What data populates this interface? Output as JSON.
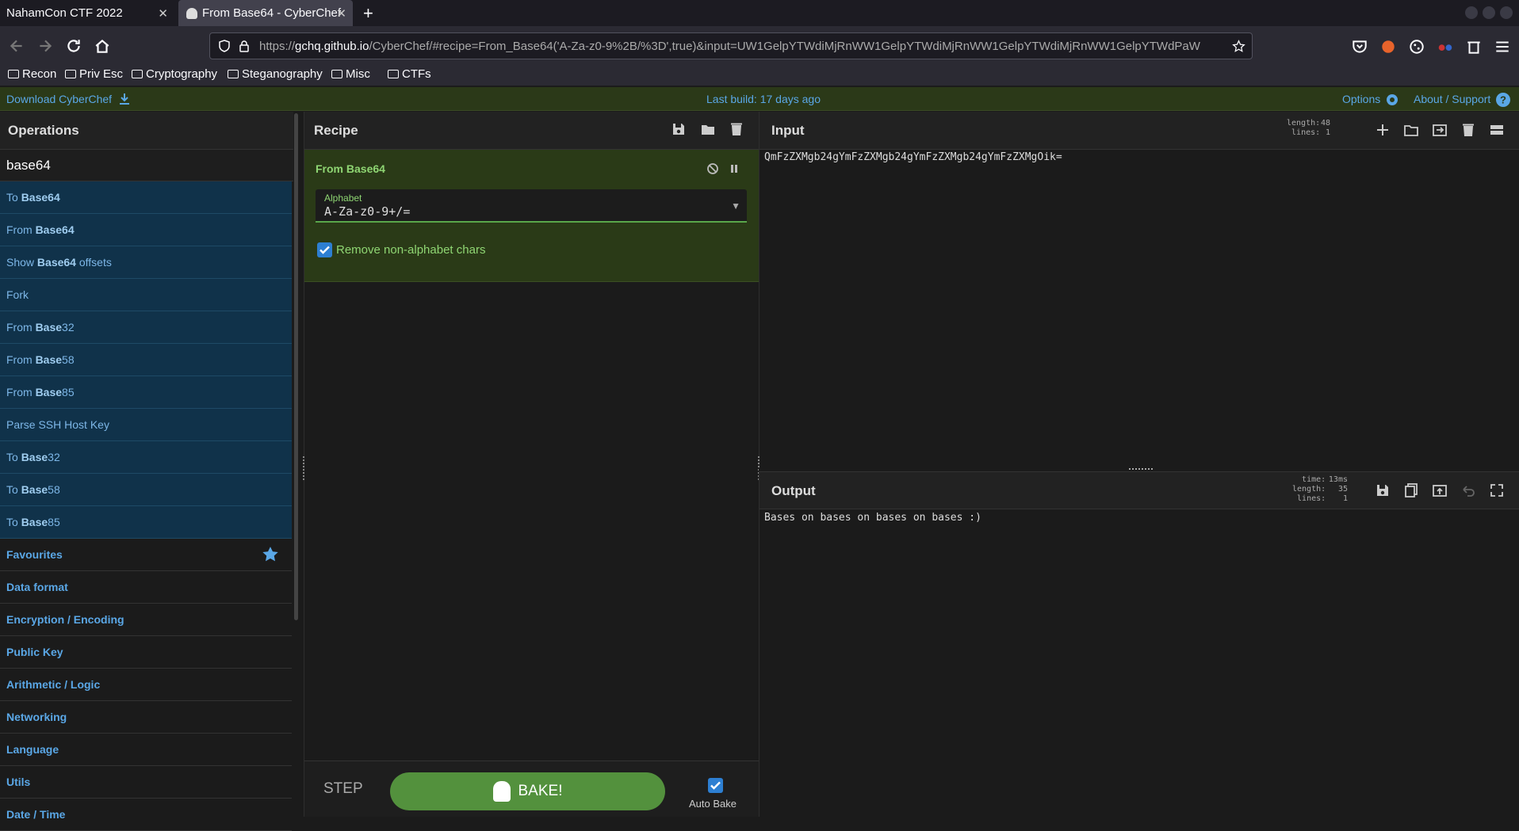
{
  "browser": {
    "tabs": [
      {
        "label": "NahamCon CTF 2022"
      },
      {
        "label": "From Base64 - CyberChef"
      }
    ],
    "url": {
      "scheme": "https://",
      "host": "gchq.github.io",
      "rest": "/CyberChef/#recipe=From_Base64('A-Za-z0-9%2B/%3D',true)&input=UW1GelpYTWdiMjRnWW1GelpYTWdiMjRnWW1GelpYTWdiMjRnWW1GelpYTWdPaW"
    },
    "bookmarks": [
      "Recon",
      "Priv Esc",
      "Cryptography",
      "Steganography",
      "Misc",
      "CTFs"
    ]
  },
  "banner": {
    "download_label": "Download CyberChef",
    "last_build": "Last build: 17 days ago",
    "options_label": "Options",
    "about_label": "About / Support"
  },
  "operations": {
    "title": "Operations",
    "search_value": "base64",
    "results": [
      {
        "pre": "To ",
        "bold": "Base64",
        "post": ""
      },
      {
        "pre": "From ",
        "bold": "Base64",
        "post": ""
      },
      {
        "pre": "Show ",
        "bold": "Base64",
        "post": " offsets"
      },
      {
        "pre": "Fork",
        "bold": "",
        "post": ""
      },
      {
        "pre": "From ",
        "bold": "Base",
        "post": "32"
      },
      {
        "pre": "From ",
        "bold": "Base",
        "post": "58"
      },
      {
        "pre": "From ",
        "bold": "Base",
        "post": "85"
      },
      {
        "pre": "Parse SSH Host Key",
        "bold": "",
        "post": ""
      },
      {
        "pre": "To ",
        "bold": "Base",
        "post": "32"
      },
      {
        "pre": "To ",
        "bold": "Base",
        "post": "58"
      },
      {
        "pre": "To ",
        "bold": "Base",
        "post": "85"
      }
    ],
    "categories": [
      "Favourites",
      "Data format",
      "Encryption / Encoding",
      "Public Key",
      "Arithmetic / Logic",
      "Networking",
      "Language",
      "Utils",
      "Date / Time"
    ]
  },
  "recipe": {
    "title": "Recipe",
    "operation_name": "From Base64",
    "alphabet_label": "Alphabet",
    "alphabet_value": "A-Za-z0-9+/=",
    "remove_label": "Remove non-alphabet chars",
    "remove_checked": true,
    "step_label": "STEP",
    "bake_label": "BAKE!",
    "autobake_label": "Auto Bake"
  },
  "input": {
    "title": "Input",
    "stats_labels": "length:\nlines:",
    "stats_values": "48\n1",
    "text": "QmFzZXMgb24gYmFzZXMgb24gYmFzZXMgb24gYmFzZXMgOik="
  },
  "output": {
    "title": "Output",
    "stats_labels": "time:\nlength:\nlines:",
    "stats_values": "13ms\n35\n1",
    "text": "Bases on bases on bases on bases :)"
  },
  "colors": {
    "accent_blue": "#5aa7e6",
    "op_green": "#8fd673",
    "bake_green": "#53913d",
    "checkbox_blue": "#2d7fd2"
  }
}
